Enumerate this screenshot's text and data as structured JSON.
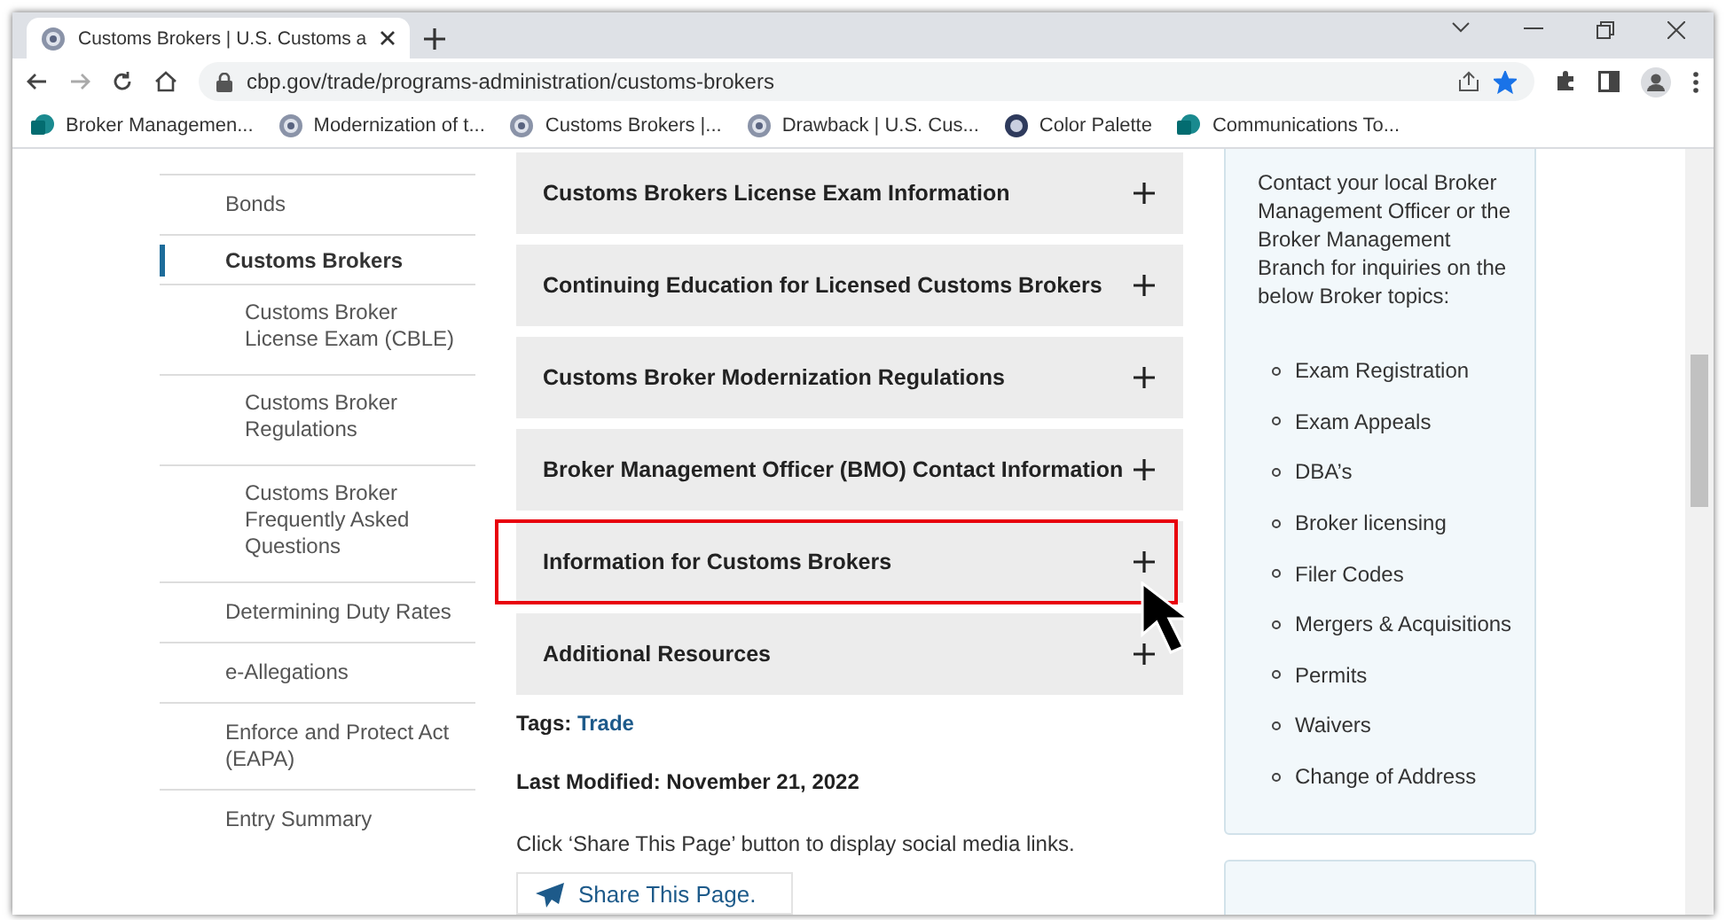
{
  "browser": {
    "tabs": [
      {
        "title": "Customs Brokers | U.S. Customs a",
        "selected": true
      }
    ],
    "url": "cbp.gov/trade/programs-administration/customs-brokers",
    "bookmarked": true,
    "bookmarks": [
      {
        "label": "Broker Managemen...",
        "kind": "sharepoint"
      },
      {
        "label": "Modernization of t...",
        "kind": "seal"
      },
      {
        "label": "Customs Brokers |...",
        "kind": "seal"
      },
      {
        "label": "Drawback | U.S. Cus...",
        "kind": "seal"
      },
      {
        "label": "Color Palette",
        "kind": "badge"
      },
      {
        "label": "Communications To...",
        "kind": "sharepoint"
      }
    ]
  },
  "sidebar": {
    "items": [
      {
        "label": "Bonds",
        "selected": false
      },
      {
        "label": "Customs Brokers",
        "selected": true,
        "children": [
          {
            "label": "Customs Broker License Exam (CBLE)",
            "selected": false
          },
          {
            "label": "Customs Broker Regulations",
            "selected": false
          },
          {
            "label": "Customs Broker Frequently Asked Questions",
            "selected": false
          }
        ]
      },
      {
        "label": "Determining Duty Rates",
        "selected": false
      },
      {
        "label": "e-Allegations",
        "selected": false
      },
      {
        "label": "Enforce and Protect Act (EAPA)",
        "selected": false
      },
      {
        "label": "Entry Summary",
        "selected": false
      }
    ]
  },
  "accordion": [
    {
      "title": "Customs Brokers License Exam Information",
      "expanded": false,
      "highlighted": false
    },
    {
      "title": "Continuing Education for Licensed Customs Brokers",
      "expanded": false,
      "highlighted": false
    },
    {
      "title": "Customs Broker Modernization Regulations",
      "expanded": false,
      "highlighted": false
    },
    {
      "title": "Broker Management Officer (BMO) Contact Information",
      "expanded": false,
      "highlighted": false
    },
    {
      "title": "Information for Customs Brokers",
      "expanded": false,
      "highlighted": true
    },
    {
      "title": "Additional Resources",
      "expanded": false,
      "highlighted": false
    }
  ],
  "tags": {
    "label": "Tags:",
    "value": "Trade"
  },
  "last_modified": "Last Modified: November 21, 2022",
  "share_note": "Click ‘Share This Page’ button to display social media links.",
  "share_button": "Share This Page.",
  "contact": {
    "text": "Contact your local Broker Management Officer or the Broker Management Branch for inquiries on the below Broker topics:",
    "topics": [
      "Exam Registration",
      "Exam Appeals",
      "DBA’s",
      "Broker licensing",
      "Filer Codes",
      "Mergers & Acquisitions",
      "Permits",
      "Waivers",
      "Change of Address"
    ]
  }
}
